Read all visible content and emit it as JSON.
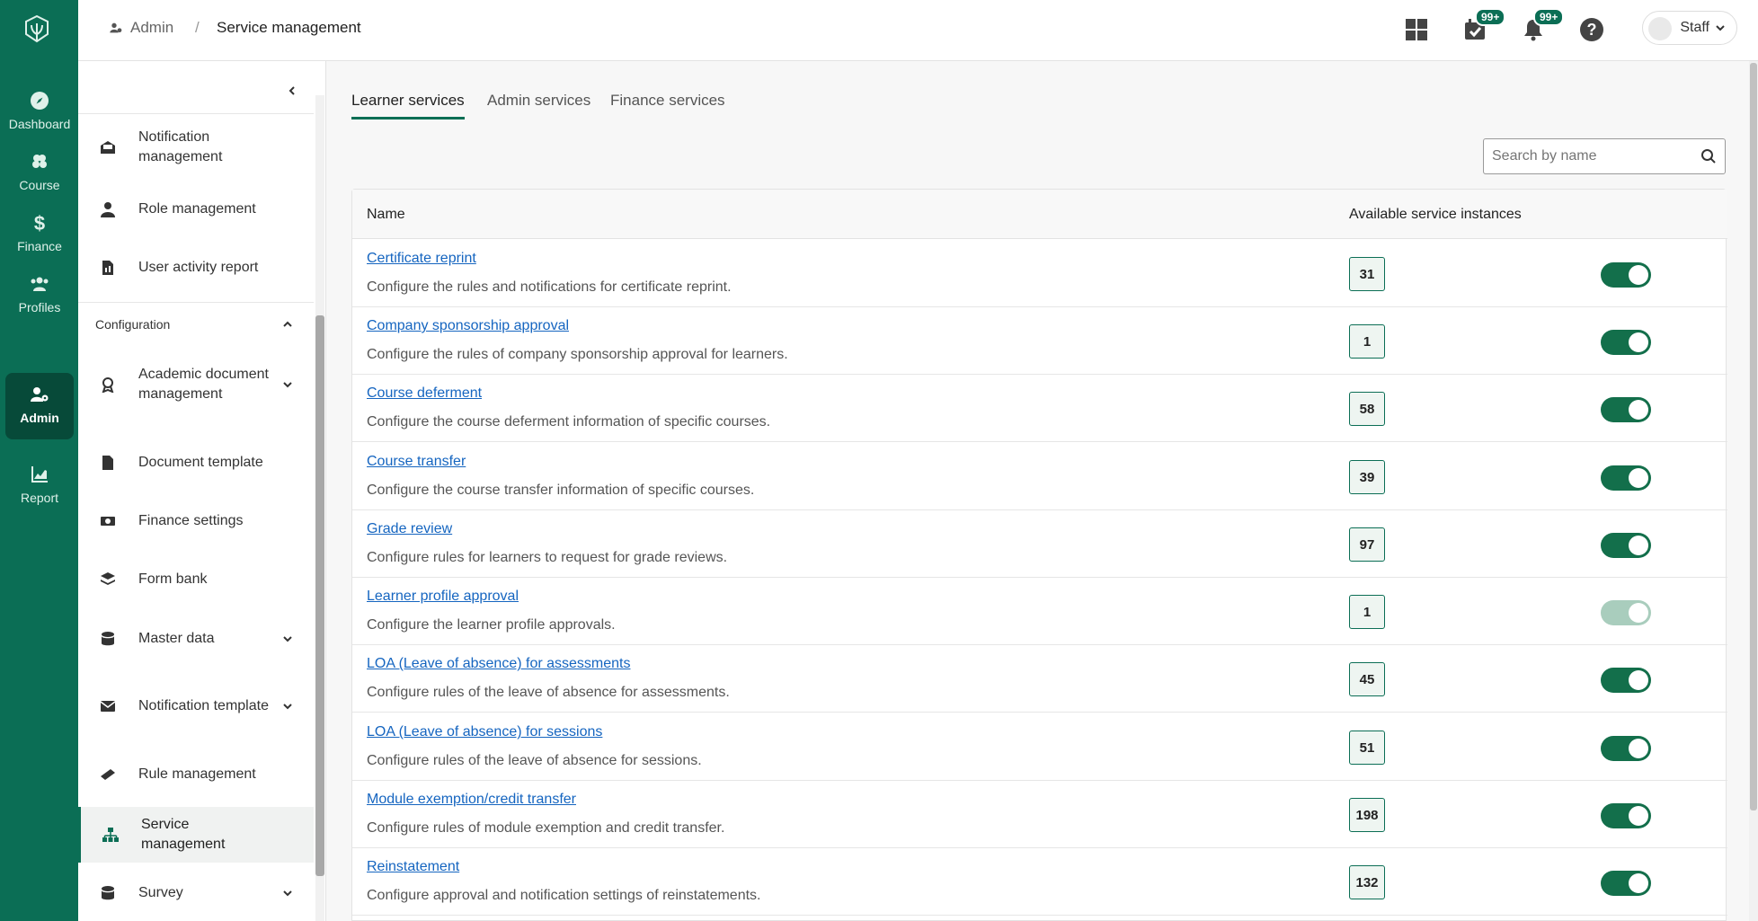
{
  "rail": {
    "items": [
      {
        "label": "Dashboard",
        "icon": "compass-icon"
      },
      {
        "label": "Course",
        "icon": "course-icon"
      },
      {
        "label": "Finance",
        "icon": "dollar-icon"
      },
      {
        "label": "Profiles",
        "icon": "users-icon"
      },
      {
        "label": "Admin",
        "icon": "user-gear-icon",
        "active": true
      },
      {
        "label": "Report",
        "icon": "chart-icon"
      }
    ]
  },
  "breadcrumb": {
    "parent": "Admin",
    "separator": "/",
    "current": "Service management"
  },
  "header": {
    "tasks_badge": "99+",
    "notifications_badge": "99+",
    "user_label": "Staff"
  },
  "sidenav": {
    "items": [
      {
        "label": "Notification management"
      },
      {
        "label": "Role management"
      },
      {
        "label": "User activity report"
      },
      {
        "label": "Academic document management"
      },
      {
        "label": "Document template"
      },
      {
        "label": "Finance settings"
      },
      {
        "label": "Form bank"
      },
      {
        "label": "Master data"
      },
      {
        "label": "Notification template"
      },
      {
        "label": "Rule management"
      },
      {
        "label": "Service management",
        "active": true
      },
      {
        "label": "Survey"
      }
    ],
    "section_label": "Configuration"
  },
  "tabs": [
    {
      "label": "Learner services",
      "active": true
    },
    {
      "label": "Admin services"
    },
    {
      "label": "Finance services"
    }
  ],
  "search": {
    "placeholder": "Search by name",
    "value": ""
  },
  "table": {
    "columns": {
      "name": "Name",
      "instances": "Available service instances"
    },
    "rows": [
      {
        "title": "Certificate reprint",
        "desc": "Configure the rules and notifications for certificate reprint.",
        "count": "31",
        "enabled": true
      },
      {
        "title": "Company sponsorship approval",
        "desc": "Configure the rules of company sponsorship approval for learners.",
        "count": "1",
        "enabled": true
      },
      {
        "title": "Course deferment",
        "desc": "Configure the course deferment information of specific courses.",
        "count": "58",
        "enabled": true
      },
      {
        "title": "Course transfer",
        "desc": "Configure the course transfer information of specific courses.",
        "count": "39",
        "enabled": true
      },
      {
        "title": "Grade review",
        "desc": "Configure rules for learners to request for grade reviews.",
        "count": "97",
        "enabled": true
      },
      {
        "title": "Learner profile approval",
        "desc": "Configure the learner profile approvals.",
        "count": "1",
        "enabled": true,
        "disabled": true
      },
      {
        "title": "LOA (Leave of absence) for assessments",
        "desc": "Configure rules of the leave of absence for assessments.",
        "count": "45",
        "enabled": true
      },
      {
        "title": "LOA (Leave of absence) for sessions",
        "desc": "Configure rules of the leave of absence for sessions.",
        "count": "51",
        "enabled": true
      },
      {
        "title": "Module exemption/credit transfer",
        "desc": "Configure rules of module exemption and credit transfer.",
        "count": "198",
        "enabled": true
      },
      {
        "title": "Reinstatement",
        "desc": "Configure approval and notification settings of reinstatements.",
        "count": "132",
        "enabled": true
      }
    ]
  },
  "colors": {
    "brand": "#0b6e55",
    "brand_dark": "#074a39",
    "link": "#1565c0"
  }
}
